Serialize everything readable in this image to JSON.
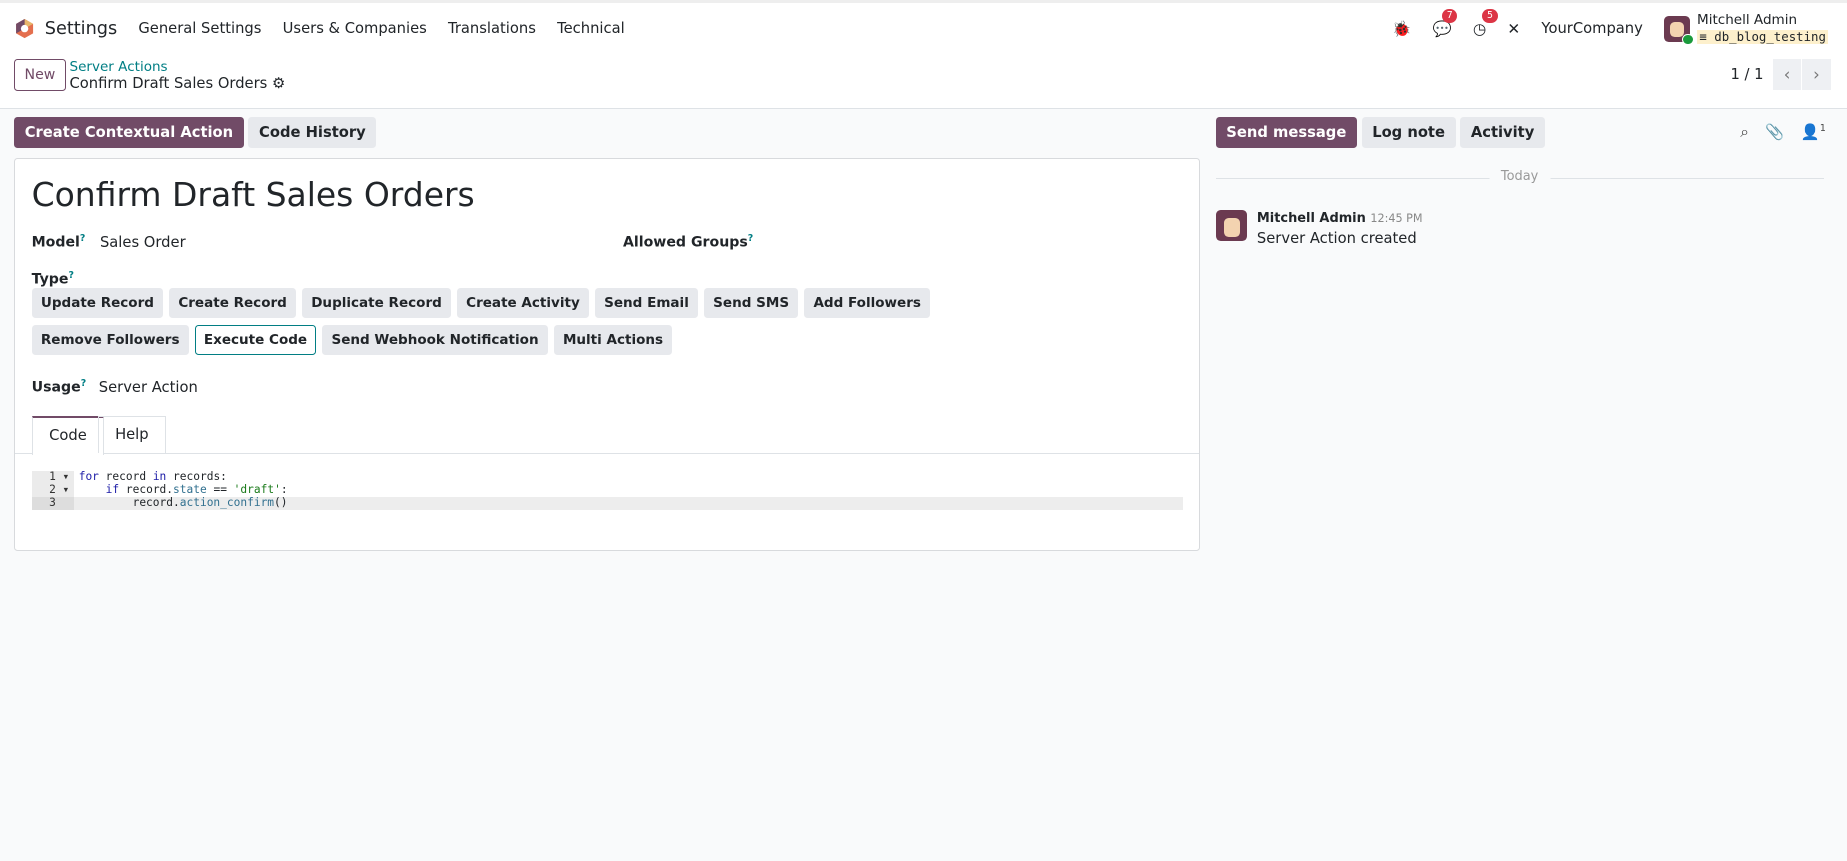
{
  "topbar": {
    "app": "Settings",
    "menus": [
      "General Settings",
      "Users & Companies",
      "Translations",
      "Technical"
    ],
    "messages_count": "7",
    "activities_count": "5",
    "company": "YourCompany",
    "user": "Mitchell Admin",
    "database": "db_blog_testing"
  },
  "control": {
    "new_label": "New",
    "breadcrumb_parent": "Server Actions",
    "breadcrumb_current": "Confirm Draft Sales Orders",
    "pager": "1 / 1"
  },
  "actions": {
    "contextual": "Create Contextual Action",
    "history": "Code History"
  },
  "form": {
    "title": "Confirm Draft Sales Orders",
    "model_label": "Model",
    "model_value": "Sales Order",
    "groups_label": "Allowed Groups",
    "type_label": "Type",
    "help_mark": "?",
    "types": [
      "Update Record",
      "Create Record",
      "Duplicate Record",
      "Create Activity",
      "Send Email",
      "Send SMS",
      "Add Followers",
      "Remove Followers",
      "Execute Code",
      "Send Webhook Notification",
      "Multi Actions"
    ],
    "selected_type": "Execute Code",
    "usage_label": "Usage",
    "usage_value": "Server Action",
    "tabs": [
      "Code",
      "Help"
    ],
    "code_lines": [
      "1",
      "2",
      "3"
    ]
  },
  "chatter": {
    "send": "Send message",
    "log": "Log note",
    "activity": "Activity",
    "followers": "1",
    "date_sep": "Today",
    "author": "Mitchell Admin",
    "time": "12:45 PM",
    "body": "Server Action created"
  }
}
